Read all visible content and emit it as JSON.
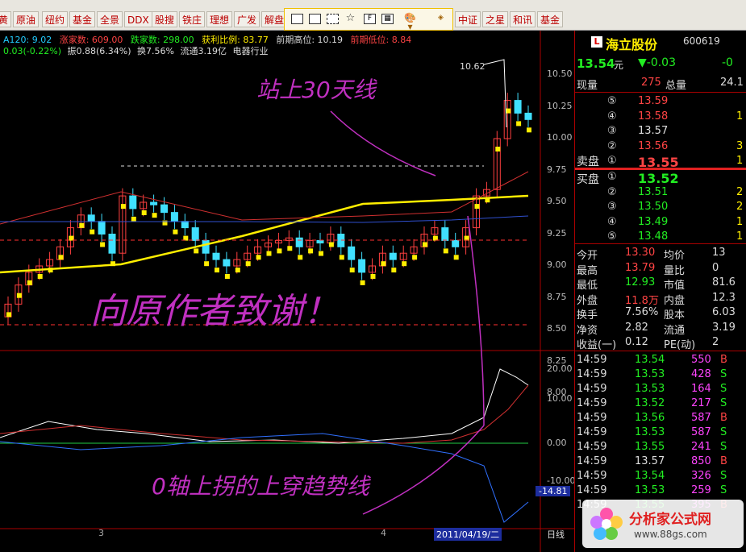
{
  "toolbar": {
    "left_buttons": [
      "黄",
      "原油",
      "纽约",
      "基金",
      "全景",
      "DDX",
      "股搜",
      "铁庄",
      "理想",
      "广发",
      "解盘"
    ],
    "right_buttons": [
      "中证",
      "之星",
      "和讯",
      "基金"
    ]
  },
  "info_line1": {
    "ma120": "A120: 9.02",
    "rise_count": "涨家数: 609.00",
    "fall_count": "跌家数: 298.00",
    "profit_ratio": "获利比例: 83.77",
    "prev_high": "前期高位: 10.19",
    "prev_low": "前期低位: 8.84"
  },
  "info_line2": {
    "change": "0.03(-0.22%)",
    "amplitude": "振0.88(6.34%)",
    "turnover": "换7.56%",
    "float": "流通3.19亿",
    "industry": "电器行业"
  },
  "chart": {
    "price_labels": [
      "10.50",
      "10.25",
      "10.00",
      "9.75",
      "9.50",
      "9.25",
      "9.00",
      "8.75",
      "8.50",
      "8.25",
      "8.00"
    ],
    "peak_label": "10.62",
    "osc_labels": [
      "20.00",
      "10.00",
      "0.00",
      "-10.00"
    ],
    "osc_value": "-14.81",
    "date_label": "2011/04/19/二",
    "period_label": "日线",
    "axis_mark_1": "3",
    "axis_mark_2": "4",
    "handwriting_1": "站上30天线",
    "handwriting_2": "向原作者致谢！",
    "handwriting_3": "0轴上拐的上穿趋势线"
  },
  "stock": {
    "logo": "L",
    "name": "海立股份",
    "code": "600619",
    "price": "13.54",
    "unit": "元",
    "change": "▼-0.03",
    "change_pct": "-0",
    "now_vol_label": "现量",
    "now_vol": "275",
    "total_label": "总量",
    "total": "24.1",
    "sell_label": "卖盘",
    "buy_label": "买盘",
    "asks": [
      {
        "n": "⑤",
        "p": "13.59",
        "v": ""
      },
      {
        "n": "④",
        "p": "13.58",
        "v": "1"
      },
      {
        "n": "③",
        "p": "13.57",
        "v": ""
      },
      {
        "n": "②",
        "p": "13.56",
        "v": "3"
      },
      {
        "n": "①",
        "p": "13.55",
        "v": "1"
      }
    ],
    "bids": [
      {
        "n": "①",
        "p": "13.52",
        "v": ""
      },
      {
        "n": "②",
        "p": "13.51",
        "v": "2"
      },
      {
        "n": "③",
        "p": "13.50",
        "v": "2"
      },
      {
        "n": "④",
        "p": "13.49",
        "v": "1"
      },
      {
        "n": "⑤",
        "p": "13.48",
        "v": "1"
      }
    ],
    "stats": [
      {
        "k1": "今开",
        "v1": "13.30",
        "c1": "r",
        "k2": "均价",
        "v2": "13"
      },
      {
        "k1": "最高",
        "v1": "13.79",
        "c1": "r",
        "k2": "量比",
        "v2": "0"
      },
      {
        "k1": "最低",
        "v1": "12.93",
        "c1": "g",
        "k2": "市值",
        "v2": "81.6"
      },
      {
        "k1": "外盘",
        "v1": "11.8万",
        "c1": "r",
        "k2": "内盘",
        "v2": "12.3"
      },
      {
        "k1": "换手",
        "v1": "7.56%",
        "c1": "w",
        "k2": "股本",
        "v2": "6.03"
      },
      {
        "k1": "净资",
        "v1": "2.82",
        "c1": "w",
        "k2": "流通",
        "v2": "3.19"
      },
      {
        "k1": "收益(一)",
        "v1": "0.12",
        "c1": "w",
        "k2": "PE(动)",
        "v2": "2"
      }
    ],
    "ticks": [
      {
        "t": "14:59",
        "p": "13.54",
        "v": "550",
        "s": "B"
      },
      {
        "t": "14:59",
        "p": "13.53",
        "v": "428",
        "s": "S"
      },
      {
        "t": "14:59",
        "p": "13.53",
        "v": "164",
        "s": "S"
      },
      {
        "t": "14:59",
        "p": "13.52",
        "v": "217",
        "s": "S"
      },
      {
        "t": "14:59",
        "p": "13.56",
        "v": "587",
        "s": "B"
      },
      {
        "t": "14:59",
        "p": "13.53",
        "v": "587",
        "s": "S"
      },
      {
        "t": "14:59",
        "p": "13.55",
        "v": "241",
        "s": "S"
      },
      {
        "t": "14:59",
        "p": "13.57",
        "v": "850",
        "s": "B"
      },
      {
        "t": "14:59",
        "p": "13.54",
        "v": "326",
        "s": "S"
      },
      {
        "t": "14:59",
        "p": "13.53",
        "v": "259",
        "s": "S"
      },
      {
        "t": "14:59",
        "p": "13.55",
        "v": "395",
        "s": "B"
      }
    ]
  },
  "watermark": {
    "title": "分析家公式网",
    "url": "www.88gs.com"
  }
}
